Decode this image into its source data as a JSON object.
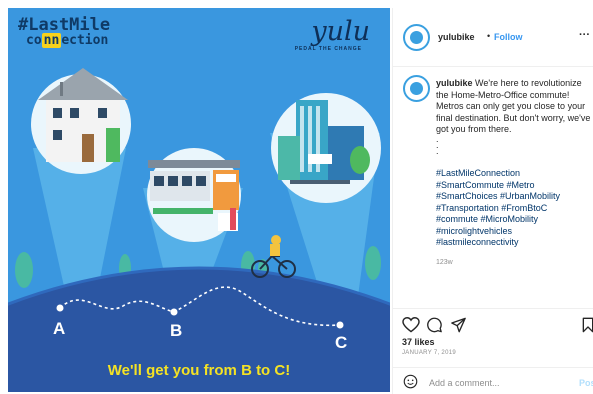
{
  "post_image": {
    "hashtag_line1": "#LastMile",
    "hashtag_line2_pre": "co",
    "hashtag_line2_hl": "nn",
    "hashtag_line2_post": "ection",
    "logo_text": "yulu",
    "logo_tagline": "PEDAL THE CHANGE",
    "station_sign": "METRO STATION",
    "point_a": "A",
    "point_b": "B",
    "point_c": "C",
    "tagline": "We'll get you from B to C!",
    "colors": {
      "sky": "#3a97df",
      "ground": "#2b56a3",
      "tagline": "#f4e224"
    }
  },
  "header": {
    "username": "yulubike",
    "separator": "•",
    "follow_label": "Follow",
    "more_icon": "more-horizontal-icon"
  },
  "caption": {
    "username": "yulubike",
    "text": "We're here to revolutionize the Home-Metro-Office commute! Metros can only get you close to your final destination. But don't worry, we've got you from there.",
    "dots": [
      ".",
      ".",
      "."
    ],
    "hashtags": [
      "#LastMileConnection",
      "#SmartCommute #Metro",
      "#SmartChoices #UrbanMobility",
      "#Transportation #FromBtoC",
      "#commute #MicroMobility",
      "#microlightvehicles",
      "#lastmileconnectivity"
    ],
    "time_ago": "123w"
  },
  "actions": {
    "icons": [
      "heart-icon",
      "comment-icon",
      "share-icon",
      "bookmark-icon"
    ],
    "likes": "37 likes",
    "date": "JANUARY 7, 2019"
  },
  "comment": {
    "placeholder": "Add a comment...",
    "post_label": "Post",
    "emoji_icon": "smile-icon"
  }
}
